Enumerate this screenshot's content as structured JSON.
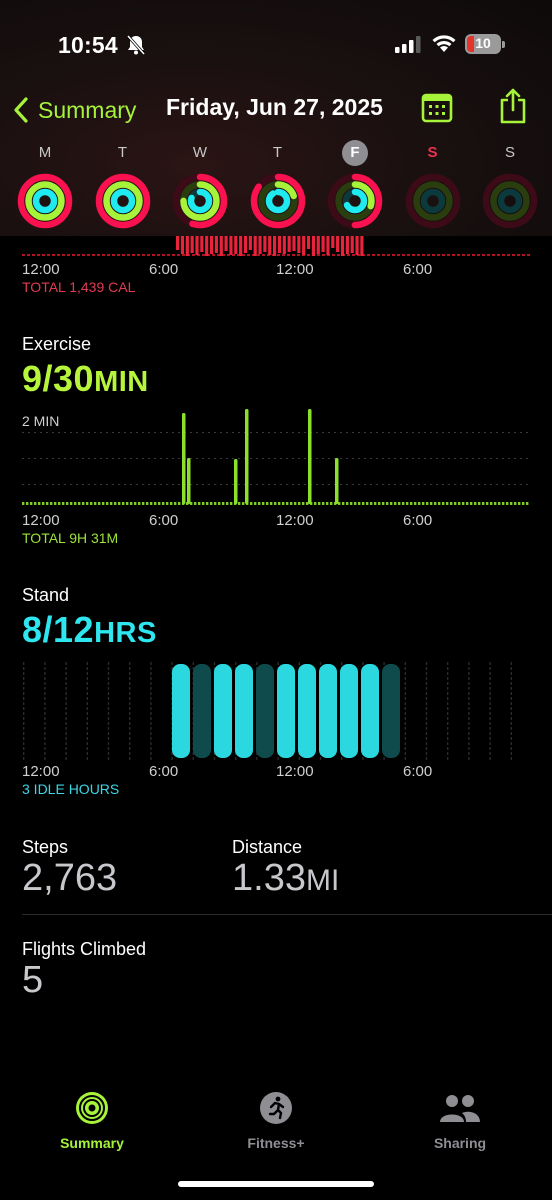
{
  "status": {
    "time": "10:54",
    "battery": "10"
  },
  "nav": {
    "back_label": "Summary",
    "title": "Friday, Jun 27, 2025"
  },
  "week": [
    {
      "letter": "M",
      "move": 1.0,
      "exercise": 1.0,
      "stand": 1.0,
      "selected": false,
      "weekend": false
    },
    {
      "letter": "T",
      "move": 1.0,
      "exercise": 1.0,
      "stand": 1.0,
      "selected": false,
      "weekend": false
    },
    {
      "letter": "W",
      "move": 0.55,
      "exercise": 0.75,
      "stand": 0.8,
      "selected": false,
      "weekend": false
    },
    {
      "letter": "T",
      "move": 0.85,
      "exercise": 0.2,
      "stand": 0.9,
      "selected": false,
      "weekend": false
    },
    {
      "letter": "F",
      "move": 0.5,
      "exercise": 0.3,
      "stand": 0.67,
      "selected": true,
      "weekend": false
    },
    {
      "letter": "S",
      "move": 0,
      "exercise": 0,
      "stand": 0,
      "selected": false,
      "weekend": true
    },
    {
      "letter": "S",
      "move": 0,
      "exercise": 0,
      "stand": 0,
      "selected": false,
      "weekend": false
    }
  ],
  "move": {
    "total": "TOTAL 1,439 CAL"
  },
  "axis_ticks": [
    "12:00",
    "6:00",
    "12:00",
    "6:00"
  ],
  "exercise": {
    "title": "Exercise",
    "value": "9/30",
    "unit": "MIN",
    "scale_label": "2 MIN",
    "total": "TOTAL 9H 31M"
  },
  "stand": {
    "title": "Stand",
    "value": "8/12",
    "unit": "HRS",
    "idle": "3 IDLE HOURS"
  },
  "steps": {
    "label": "Steps",
    "value": "2,763"
  },
  "distance": {
    "label": "Distance",
    "value": "1.33",
    "unit": "MI"
  },
  "flights": {
    "label": "Flights Climbed",
    "value": "5"
  },
  "tabs": [
    {
      "label": "Summary",
      "active": true
    },
    {
      "label": "Fitness+",
      "active": false
    },
    {
      "label": "Sharing",
      "active": false
    }
  ],
  "colors": {
    "move": "#fa114f",
    "exercise": "#a6f33a",
    "stand": "#1eeaef"
  }
}
